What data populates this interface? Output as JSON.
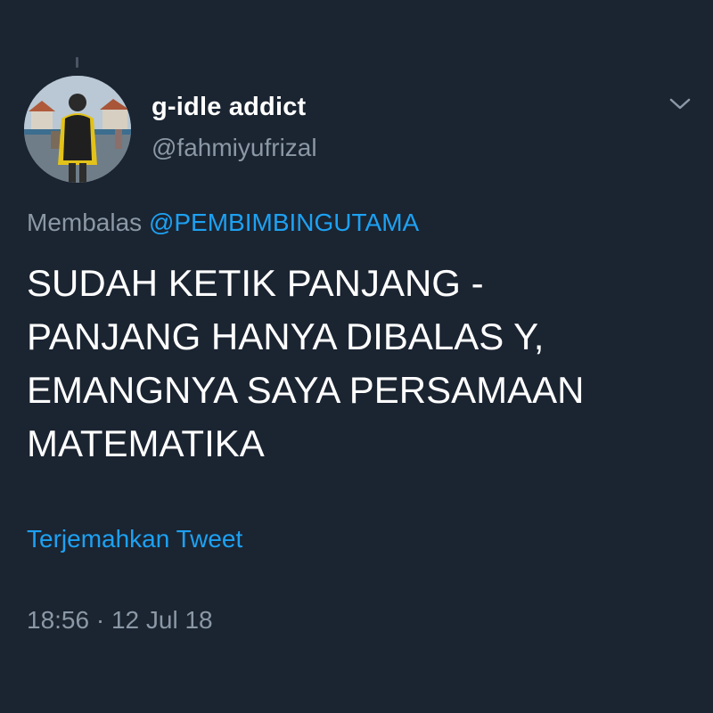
{
  "tweet": {
    "author": {
      "display_name": "g-idle addict",
      "handle": "@fahmiyufrizal"
    },
    "reply": {
      "prefix": "Membalas",
      "mention": "@PEMBIMBINGUTAMA"
    },
    "text_lines": [
      "SUDAH KETIK PANJANG -",
      "PANJANG HANYA DIBALAS Y,",
      "EMANGNYA SAYA PERSAMAAN",
      "MATEMATIKA"
    ],
    "translate_label": "Terjemahkan Tweet",
    "timestamp": "18:56 · 12 Jul 18"
  },
  "icons": {
    "menu": "chevron-down-icon"
  },
  "colors": {
    "background": "#1b2431",
    "text_primary": "#ffffff",
    "text_secondary": "#8b98a5",
    "link": "#1da1f2"
  }
}
